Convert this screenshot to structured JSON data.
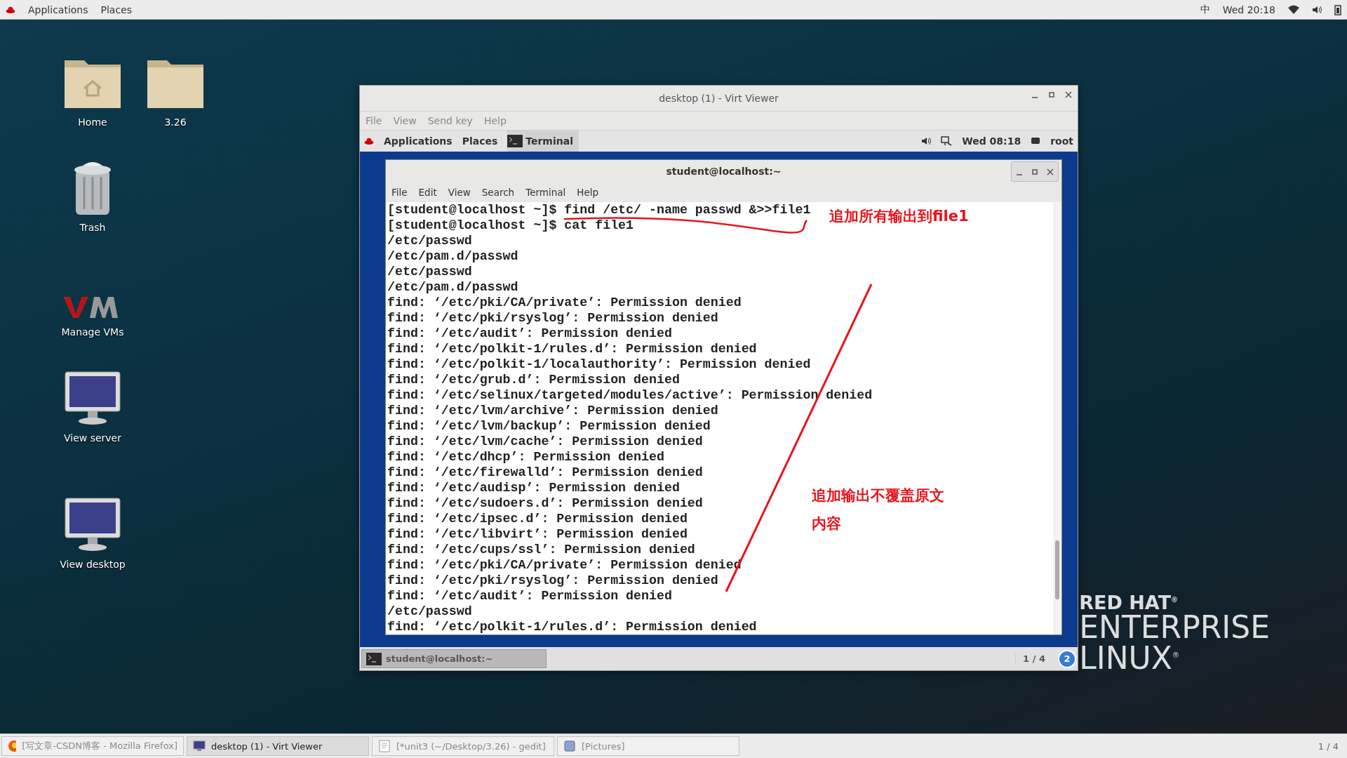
{
  "top_bar": {
    "menus": [
      "Applications",
      "Places"
    ],
    "input_method": "中",
    "clock": "Wed 20:18"
  },
  "desktop_icons": [
    {
      "label": "Home",
      "kind": "home"
    },
    {
      "label": "3.26",
      "kind": "folder"
    },
    {
      "label": "Trash",
      "kind": "trash"
    },
    {
      "label": "Manage VMs",
      "kind": "vm"
    },
    {
      "label": "View server",
      "kind": "monitor"
    },
    {
      "label": "View desktop",
      "kind": "monitor"
    }
  ],
  "virt_viewer": {
    "title": "desktop (1) - Virt Viewer",
    "menus": [
      "File",
      "View",
      "Send key",
      "Help"
    ],
    "guest_top_bar": {
      "menus": [
        "Applications",
        "Places"
      ],
      "task": "Terminal",
      "clock": "Wed 08:18",
      "user": "root"
    },
    "terminal": {
      "title": "student@localhost:~",
      "menus": [
        "File",
        "Edit",
        "View",
        "Search",
        "Terminal",
        "Help"
      ],
      "lines": [
        "[student@localhost ~]$ find /etc/ -name passwd &>>file1",
        "[student@localhost ~]$ cat file1",
        "/etc/passwd",
        "/etc/pam.d/passwd",
        "/etc/passwd",
        "/etc/pam.d/passwd",
        "find: ‘/etc/pki/CA/private’: Permission denied",
        "find: ‘/etc/pki/rsyslog’: Permission denied",
        "find: ‘/etc/audit’: Permission denied",
        "find: ‘/etc/polkit-1/rules.d’: Permission denied",
        "find: ‘/etc/polkit-1/localauthority’: Permission denied",
        "find: ‘/etc/grub.d’: Permission denied",
        "find: ‘/etc/selinux/targeted/modules/active’: Permission denied",
        "find: ‘/etc/lvm/archive’: Permission denied",
        "find: ‘/etc/lvm/backup’: Permission denied",
        "find: ‘/etc/lvm/cache’: Permission denied",
        "find: ‘/etc/dhcp’: Permission denied",
        "find: ‘/etc/firewalld’: Permission denied",
        "find: ‘/etc/audisp’: Permission denied",
        "find: ‘/etc/sudoers.d’: Permission denied",
        "find: ‘/etc/ipsec.d’: Permission denied",
        "find: ‘/etc/libvirt’: Permission denied",
        "find: ‘/etc/cups/ssl’: Permission denied",
        "find: ‘/etc/pki/CA/private’: Permission denied",
        "find: ‘/etc/pki/rsyslog’: Permission denied",
        "find: ‘/etc/audit’: Permission denied",
        "/etc/passwd",
        "find: ‘/etc/polkit-1/rules.d’: Permission denied"
      ]
    },
    "annotations": [
      "追加所有输出到file1",
      "追加输出不覆盖原文",
      "内容"
    ],
    "guest_bottom_bar": {
      "task": "student@localhost:~",
      "workspace": "1 / 4",
      "badge": "2"
    }
  },
  "logo": {
    "lines": [
      "RED HAT$^{®}$",
      "ENTERPRISE",
      "LINUX$^{®}$"
    ]
  },
  "taskbar": {
    "items": [
      {
        "label": "[写文章-CSDN博客 - Mozilla Firefox]",
        "kind": "browser",
        "selected": false
      },
      {
        "label": "desktop (1) - Virt Viewer",
        "kind": "viewer",
        "selected": true
      },
      {
        "label": "[*unit3 (~/Desktop/3.26) - gedit]",
        "kind": "editor",
        "selected": false
      },
      {
        "label": "[Pictures]",
        "kind": "files",
        "selected": false
      }
    ],
    "workspace": "1 / 4"
  }
}
